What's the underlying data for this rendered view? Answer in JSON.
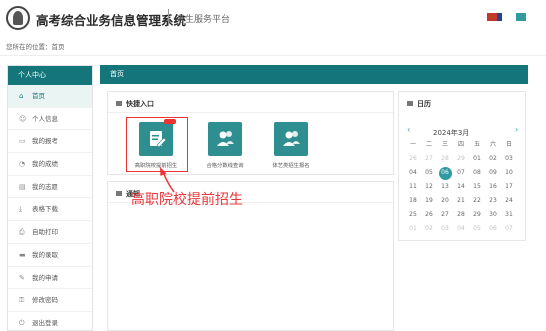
{
  "header": {
    "title": "高考综合业务信息管理系统",
    "subtitle": "考生服务平台",
    "accent_squares": [
      "#c0392b",
      "#2c3e91",
      "#2f9aa0"
    ]
  },
  "breadcrumb": {
    "label": "您所在的位置：",
    "current": "首页"
  },
  "sidebar": {
    "title": "个人中心",
    "items": [
      {
        "label": "首页",
        "icon": "home-icon",
        "glyph": "⌂",
        "active": true
      },
      {
        "label": "个人信息",
        "icon": "user-icon",
        "glyph": "☺",
        "active": false
      },
      {
        "label": "我的报考",
        "icon": "id-card-icon",
        "glyph": "▭",
        "active": false
      },
      {
        "label": "我的成绩",
        "icon": "chart-icon",
        "glyph": "◔",
        "active": false
      },
      {
        "label": "我的志愿",
        "icon": "document-icon",
        "glyph": "▤",
        "active": false
      },
      {
        "label": "表格下载",
        "icon": "download-icon",
        "glyph": "⤓",
        "active": false
      },
      {
        "label": "自助打印",
        "icon": "printer-icon",
        "glyph": "⎙",
        "active": false
      },
      {
        "label": "我的录取",
        "icon": "folder-icon",
        "glyph": "▬",
        "active": false
      },
      {
        "label": "我的申请",
        "icon": "edit-icon",
        "glyph": "✎",
        "active": false
      },
      {
        "label": "修改密码",
        "icon": "lock-icon",
        "glyph": "⚿",
        "active": false
      },
      {
        "label": "退出登录",
        "icon": "logout-icon",
        "glyph": "⏻",
        "active": false
      }
    ]
  },
  "main": {
    "tab": "首页",
    "quick_entry": {
      "title": "快捷入口",
      "tiles": [
        {
          "label": "高职院校提前招生",
          "icon": "form-pencil-icon",
          "highlighted": true
        },
        {
          "label": "合格分数线查询",
          "icon": "people-icon",
          "highlighted": false
        },
        {
          "label": "体艺类招生报名",
          "icon": "people-icon",
          "highlighted": false
        }
      ]
    },
    "notice": {
      "title": "通知"
    },
    "annotation": "高职院校提前招生"
  },
  "calendar": {
    "title": "日历",
    "month_label": "2024年3月",
    "prev": "‹",
    "next": "›",
    "weekdays": [
      "一",
      "二",
      "三",
      "四",
      "五",
      "六",
      "日"
    ],
    "weeks": [
      [
        "26",
        "27",
        "28",
        "29",
        "01",
        "02",
        "03"
      ],
      [
        "04",
        "05",
        "06",
        "07",
        "08",
        "09",
        "10"
      ],
      [
        "11",
        "12",
        "13",
        "14",
        "15",
        "16",
        "17"
      ],
      [
        "18",
        "19",
        "20",
        "21",
        "22",
        "23",
        "24"
      ],
      [
        "25",
        "26",
        "27",
        "28",
        "29",
        "30",
        "31"
      ],
      [
        "01",
        "02",
        "03",
        "04",
        "05",
        "06",
        "07"
      ]
    ],
    "today": "06",
    "accent": "#2f9aa0"
  }
}
